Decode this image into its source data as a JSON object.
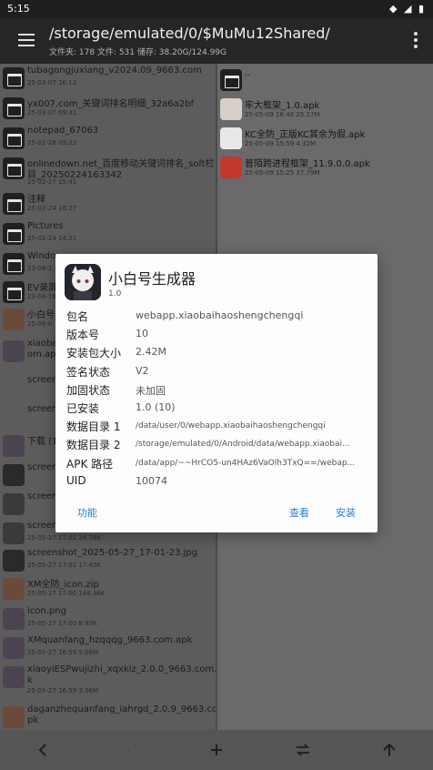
{
  "status": {
    "time": "5:15"
  },
  "appbar": {
    "path": "/storage/emulated/0/$MuMu12Shared/",
    "info": "文件夹: 178  文件: 531  储存: 38.20G/124.99G"
  },
  "left_pane": [
    {
      "name": "tubagongjuxiang_v2024.09_9663.com",
      "meta": "25-03-07 16:12",
      "kind": "folder"
    },
    {
      "name": "yx007.com_关键词排名明细_32a6a2bf",
      "meta": "25-03-07 09:41",
      "kind": "folder"
    },
    {
      "name": "notepad_67063",
      "meta": "25-02-28 09:22",
      "kind": "folder"
    },
    {
      "name": "onlinedown.net_百度移动关键词排名_soft栏",
      "name2": "目_20250224163342",
      "meta": "25-02-27 15:41",
      "kind": "folder"
    },
    {
      "name": "注释",
      "meta": "25-02-24 16:27",
      "kind": "folder"
    },
    {
      "name": "Pictures",
      "meta": "25-02-24 14:21",
      "kind": "folder"
    },
    {
      "name": "Windo",
      "meta": "23-06-1",
      "kind": "folder"
    },
    {
      "name": "EV录屏",
      "meta": "23-04-18",
      "kind": "folder"
    },
    {
      "name": "小白号",
      "meta": "25-06-0",
      "kind": "zip"
    },
    {
      "name": "xiaoba",
      "name2": "om.apk",
      "meta": "",
      "kind": "anime"
    },
    {
      "name": "screen",
      "meta": "",
      "kind": "none"
    },
    {
      "name": "screen",
      "meta": "",
      "kind": "none"
    },
    {
      "name": "下载 (1",
      "meta": "",
      "kind": "anime"
    },
    {
      "name": "screen",
      "meta": "",
      "kind": "dark"
    },
    {
      "name": "screen",
      "meta": "",
      "kind": "mid"
    },
    {
      "name": "screen",
      "meta": "25-05-27 17:01  24.76K",
      "kind": "mid"
    },
    {
      "name": "screenshot_2025-05-27_17-01-23.jpg",
      "meta": "25-05-27 17:01  17.45K",
      "kind": "dark"
    },
    {
      "name": "XM全防_icon.zip",
      "meta": "25-05-27 17:00  144.36K",
      "kind": "zip"
    },
    {
      "name": "icon.png",
      "meta": "25-05-27 17:00  8.93K",
      "kind": "anime"
    },
    {
      "name": "XMquanfang_hzqqqg_9663.com.apk",
      "meta": "25-05-27 16:59  5.06M",
      "kind": "anime"
    },
    {
      "name": "xiaoyiESPwujizhi_xqxkiz_2.0.0_9663.com.ap",
      "name2": "k",
      "meta": "25-05-27 16:59  3.56M",
      "kind": "anime"
    },
    {
      "name": "daganzhequanfang_iahrgd_2.0.9_9663.com.a",
      "name2": "pk",
      "meta": "",
      "kind": "zip"
    }
  ],
  "right_pane": [
    {
      "name": "..",
      "meta": "",
      "kind": "folder"
    },
    {
      "name": "牢大框架_1.0.apk",
      "meta": "25-05-09 16:48  25.17M"
    },
    {
      "name": "KC全防_正版KC其余为假.apk",
      "meta": "25-05-09 15:59  4.32M"
    },
    {
      "name": "普陌跨进程框架_11.9.0.0.apk",
      "meta": "25-05-09 15:25  37.79M"
    }
  ],
  "dialog": {
    "app_name": "小白号生成器",
    "app_version": "1.0",
    "rows": [
      {
        "key": "包名",
        "value": "webapp.xiaobaihaoshengchengqi"
      },
      {
        "key": "版本号",
        "value": "10"
      },
      {
        "key": "安装包大小",
        "value": "2.42M"
      },
      {
        "key": "签名状态",
        "value": "V2"
      },
      {
        "key": "加固状态",
        "value": "未加固"
      },
      {
        "key": "已安装",
        "value": "1.0 (10)"
      },
      {
        "key": "数据目录 1",
        "value": "/data/user/0/webapp.xiaobaihaoshengchengqi"
      },
      {
        "key": "数据目录 2",
        "value": "/storage/emulated/0/Android/data/webapp.xiaobai..."
      },
      {
        "key": "APK 路径",
        "value": "/data/app/~~HrCO5-un4HAz6VaOlh3TxQ==/webap..."
      },
      {
        "key": "UID",
        "value": "10074"
      }
    ],
    "btn_function": "功能",
    "btn_view": "查看",
    "btn_install": "安装"
  }
}
